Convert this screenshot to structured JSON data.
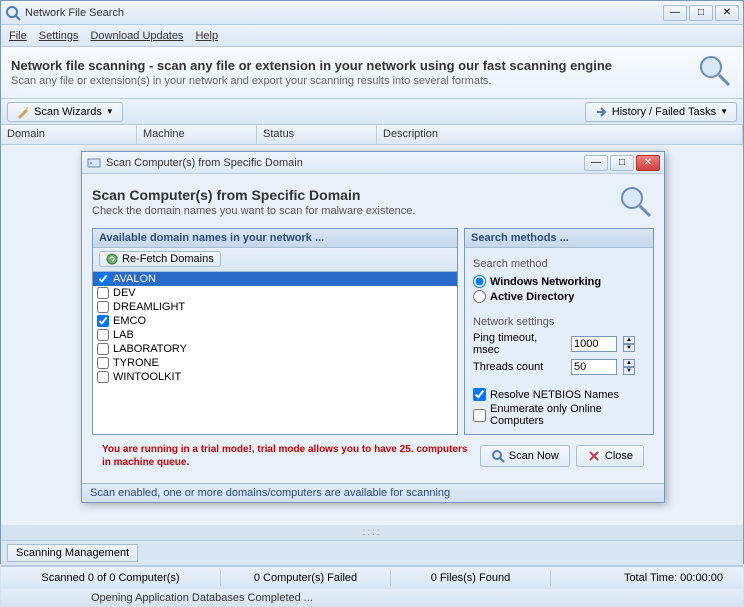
{
  "window": {
    "title": "Network File Search"
  },
  "menu": {
    "file": "File",
    "settings": "Settings",
    "download": "Download Updates",
    "help": "Help"
  },
  "banner": {
    "title": "Network file scanning - scan any file or extension in your network using our fast scanning engine",
    "subtitle": "Scan any file or extension(s) in your network and export your scanning results into several formats."
  },
  "toolbar": {
    "scan_wizards": "Scan Wizards",
    "history": "History / Failed Tasks"
  },
  "columns": {
    "domain": "Domain",
    "machine": "Machine",
    "status": "Status",
    "description": "Description"
  },
  "dialog": {
    "titlebar": "Scan Computer(s) from Specific Domain",
    "title": "Scan Computer(s) from Specific Domain",
    "subtitle": "Check the domain names you want to scan for malware existence.",
    "left_header": "Available domain names in your network ...",
    "refetch": "Re-Fetch Domains",
    "domains": [
      {
        "name": "AVALON",
        "checked": true,
        "selected": true
      },
      {
        "name": "DEV",
        "checked": false,
        "selected": false
      },
      {
        "name": "DREAMLIGHT",
        "checked": false,
        "selected": false
      },
      {
        "name": "EMCO",
        "checked": true,
        "selected": false
      },
      {
        "name": "LAB",
        "checked": false,
        "selected": false
      },
      {
        "name": "LABORATORY",
        "checked": false,
        "selected": false
      },
      {
        "name": "TYRONE",
        "checked": false,
        "selected": false
      },
      {
        "name": "WINTOOLKIT",
        "checked": false,
        "selected": false
      }
    ],
    "right_header": "Search methods ...",
    "search_method_label": "Search method",
    "radio_windows": "Windows Networking",
    "radio_ad": "Active Directory",
    "network_settings_label": "Network settings",
    "ping_label": "Ping timeout, msec",
    "ping_value": "1000",
    "threads_label": "Threads count",
    "threads_value": "50",
    "resolve_netbios": "Resolve NETBIOS Names",
    "enumerate_online": "Enumerate only Online Computers",
    "trial_text": "You are running in a trial mode!, trial mode allows you to have 25. computers in machine queue.",
    "scan_now": "Scan Now",
    "close": "Close",
    "status": "Scan enabled, one or more domains/computers are available for scanning"
  },
  "tab": {
    "scanning_mgmt": "Scanning Management"
  },
  "status": {
    "scanned": "Scanned 0 of 0 Computer(s)",
    "failed": "0 Computer(s) Failed",
    "files": "0 Files(s) Found",
    "time": "Total Time: 00:00:00",
    "opening": "Opening Application Databases Completed ..."
  }
}
